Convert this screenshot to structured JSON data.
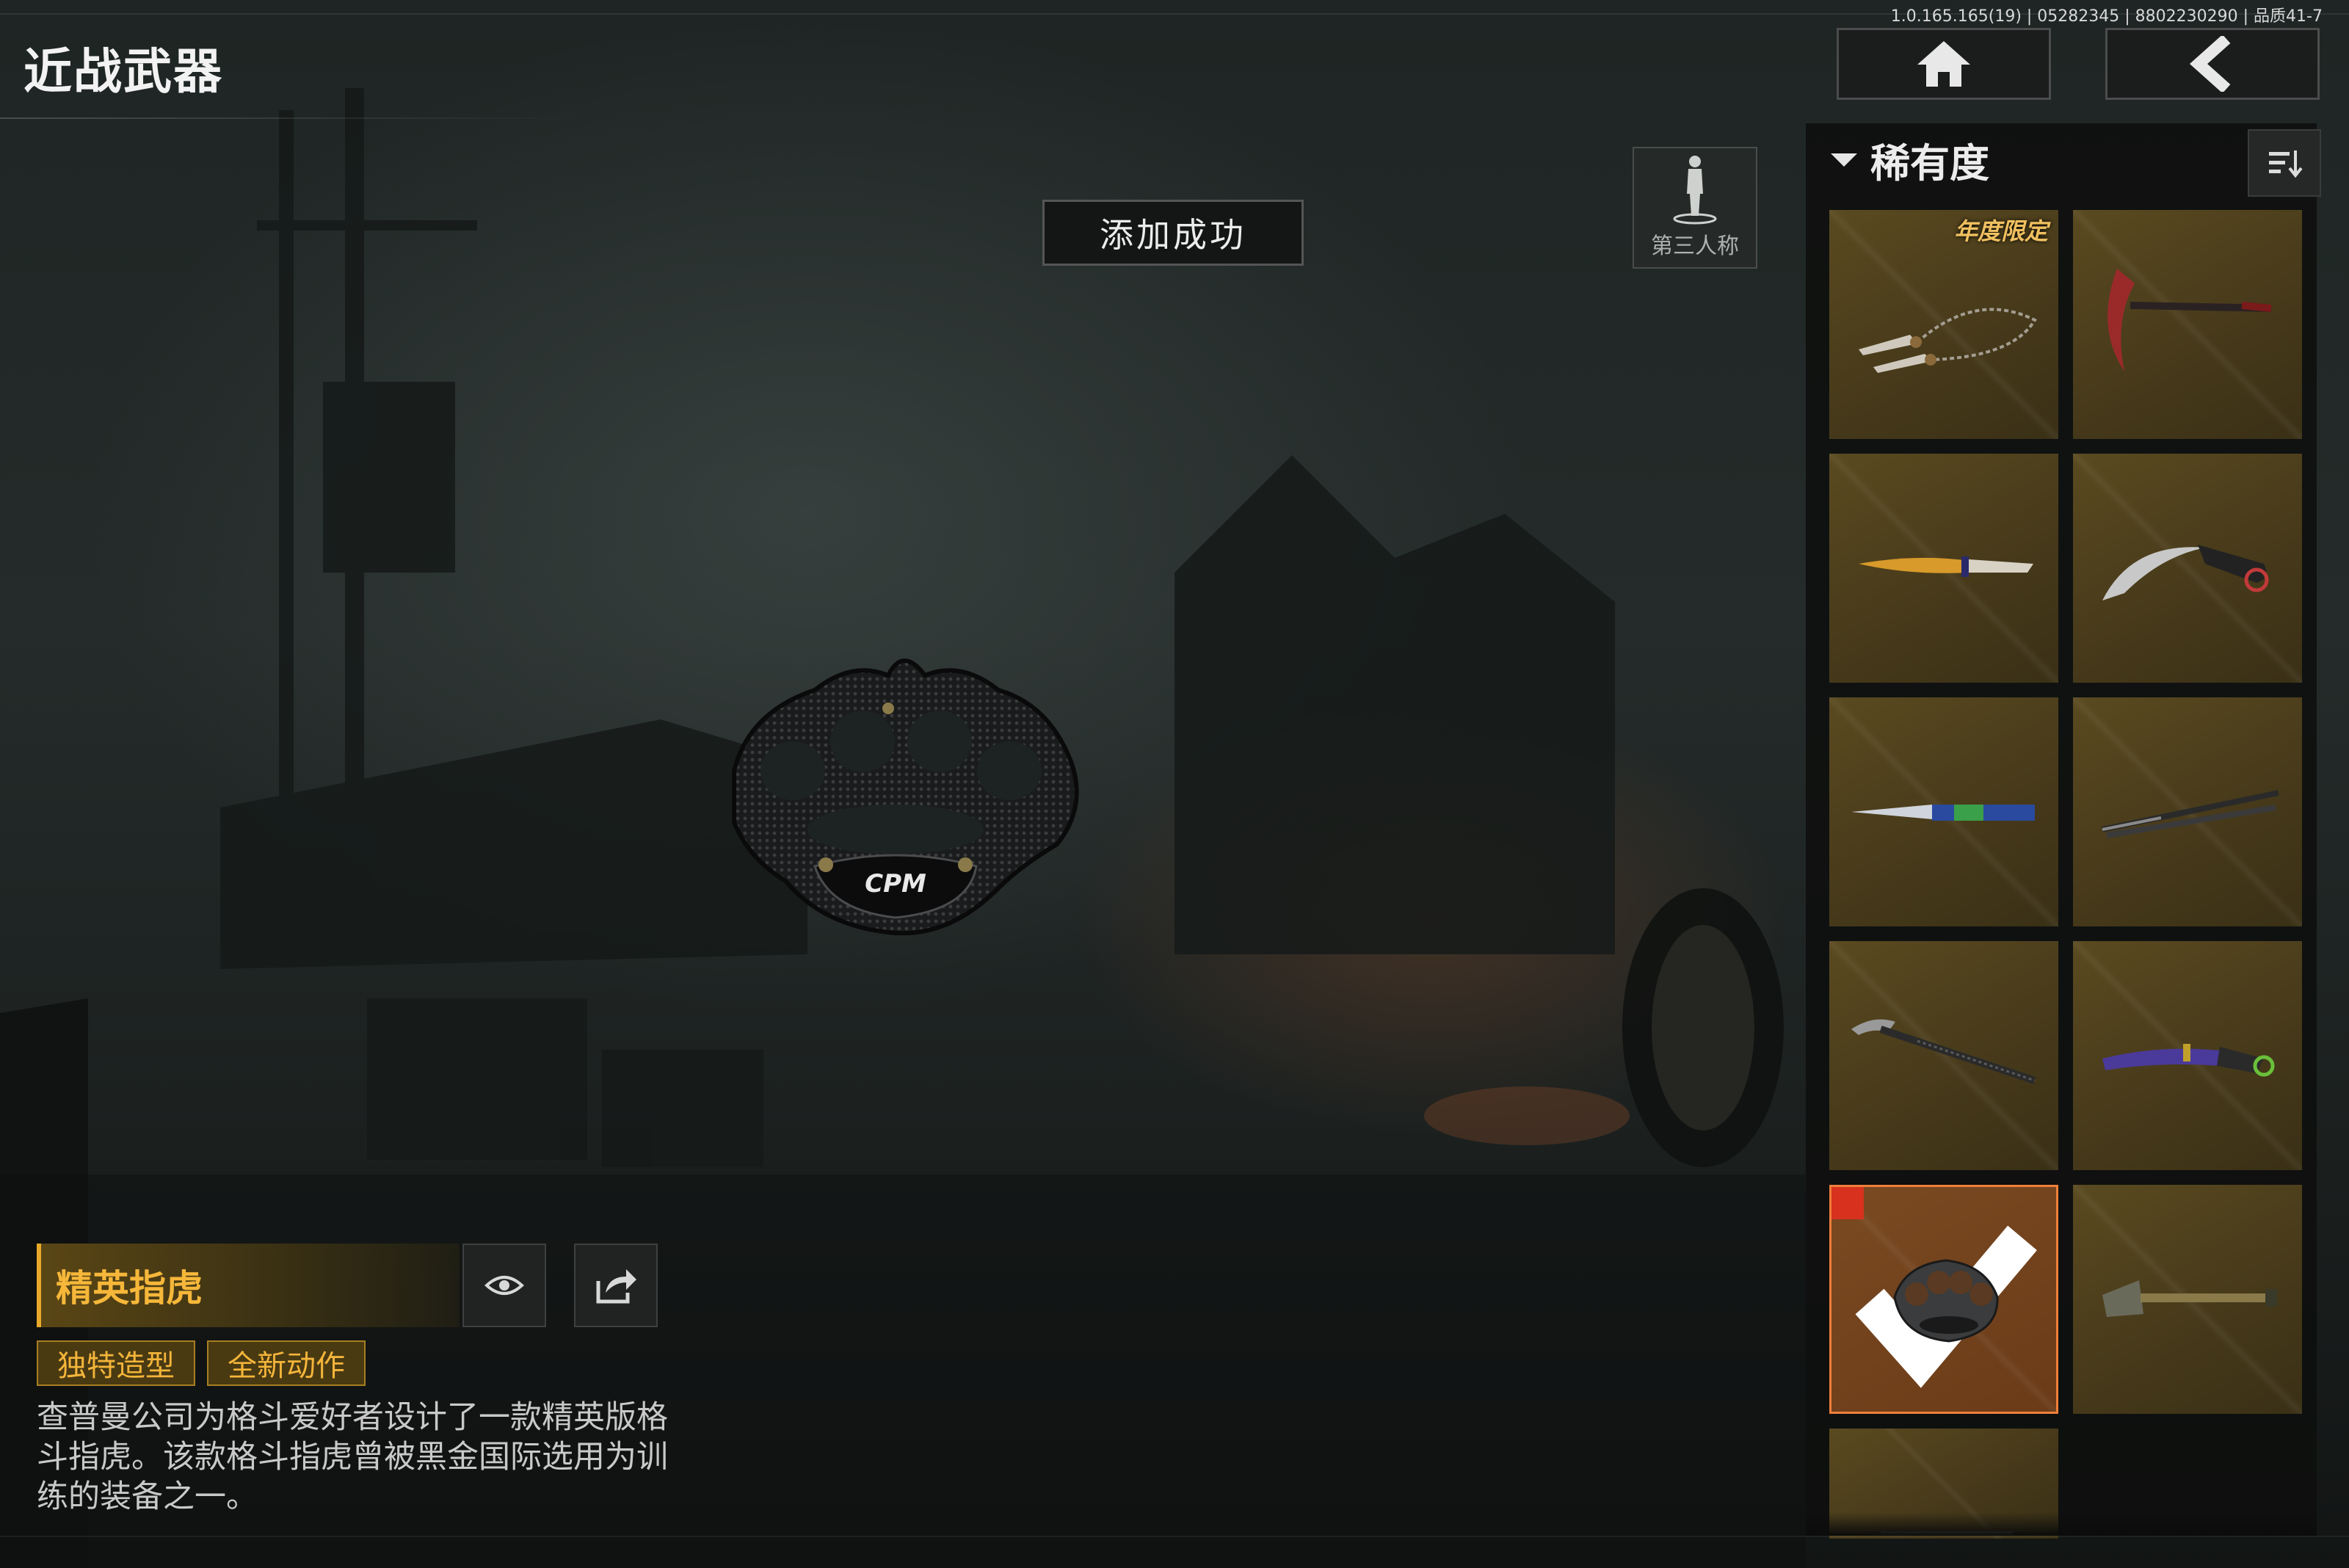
{
  "version_info": "1.0.165.165(19) | 05282345 | 8802230290 | 品质41-7",
  "page_title": "近战武器",
  "toast_message": "添加成功",
  "view_toggle": {
    "label": "第三人称",
    "icon": "person-icon"
  },
  "nav": {
    "home_icon": "home-icon",
    "back_icon": "back-icon"
  },
  "panel": {
    "header": "稀有度",
    "sort_icon": "sort-icon",
    "items": [
      {
        "name": "chain-kunai",
        "badge": "年度限定",
        "selected": false
      },
      {
        "name": "sickle",
        "badge": "",
        "selected": false
      },
      {
        "name": "golden-knife",
        "badge": "",
        "selected": false
      },
      {
        "name": "karambit",
        "badge": "",
        "selected": false
      },
      {
        "name": "butterfly-knife",
        "badge": "",
        "selected": false
      },
      {
        "name": "dual-swords",
        "badge": "",
        "selected": false
      },
      {
        "name": "ice-axe",
        "badge": "",
        "selected": false
      },
      {
        "name": "purple-karambit",
        "badge": "",
        "selected": false
      },
      {
        "name": "brass-knuckles",
        "badge": "",
        "selected": true
      },
      {
        "name": "shovel",
        "badge": "",
        "selected": false
      },
      {
        "name": "partial-item",
        "badge": "",
        "selected": false
      }
    ]
  },
  "item_detail": {
    "name": "精英指虎",
    "tags": [
      "独特造型",
      "全新动作"
    ],
    "description": "查普曼公司为格斗爱好者设计了一款精英版格斗指虎。该款格斗指虎曾被黑金国际选用为训练的装备之一。",
    "preview_icon": "eye-icon",
    "share_icon": "share-icon",
    "logo_text": "CPM"
  },
  "colors": {
    "accent": "#f6b73a",
    "selected_border": "#f07f3a",
    "check": "#d8321e",
    "card_bg": "#4a3c1b"
  }
}
